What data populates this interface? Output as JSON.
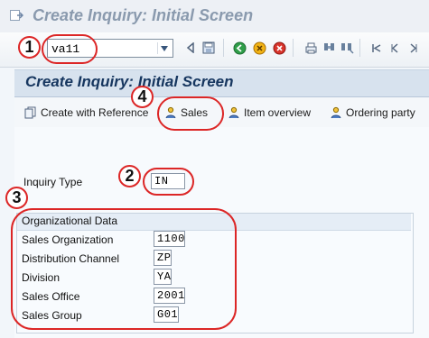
{
  "window": {
    "title": "Create Inquiry: Initial Screen",
    "icon": "app-menu-icon"
  },
  "toolbar": {
    "command_field_value": "va11"
  },
  "screen": {
    "title": "Create Inquiry: Initial Screen"
  },
  "app_toolbar": {
    "create_with_reference": "Create with Reference",
    "sales": "Sales",
    "item_overview": "Item overview",
    "ordering_party": "Ordering party"
  },
  "form": {
    "inquiry_type_label": "Inquiry Type",
    "inquiry_type_value": "IN",
    "org_group_title": "Organizational Data",
    "fields": [
      {
        "label": "Sales Organization",
        "value": "1100"
      },
      {
        "label": "Distribution Channel",
        "value": "ZP"
      },
      {
        "label": "Division",
        "value": "YA"
      },
      {
        "label": "Sales Office",
        "value": "2001"
      },
      {
        "label": "Sales Group",
        "value": "G01"
      }
    ]
  },
  "annotations": [
    "1",
    "2",
    "3",
    "4"
  ],
  "colors": {
    "annotation": "#dc2626",
    "header_bg": "#d7e2ee",
    "title_text": "#16365f"
  }
}
